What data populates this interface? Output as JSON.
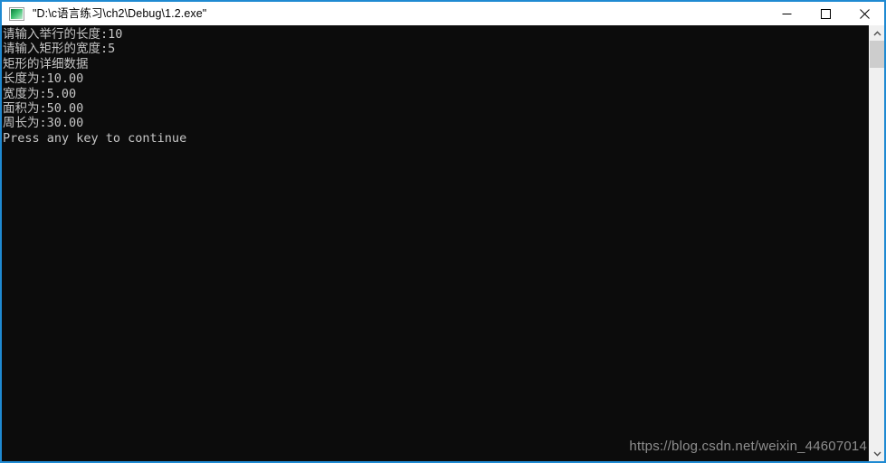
{
  "window": {
    "title": "\"D:\\c语言练习\\ch2\\Debug\\1.2.exe\"",
    "icon": "console-app-icon",
    "border_color": "#1f8ad2",
    "titlebar_bg": "#ffffff",
    "console_bg": "#0c0c0c",
    "console_fg": "#c6c6c6",
    "controls": {
      "minimize_label": "minimize",
      "maximize_label": "maximize",
      "close_label": "close"
    }
  },
  "console": {
    "lines": [
      "请输入举行的长度:10",
      "请输入矩形的宽度:5",
      "矩形的详细数据",
      "长度为:10.00",
      "宽度为:5.00",
      "面积为:50.00",
      "周长为:30.00",
      "Press any key to continue"
    ],
    "text": "请输入举行的长度:10\n请输入矩形的宽度:5\n矩形的详细数据\n长度为:10.00\n宽度为:5.00\n面积为:50.00\n周长为:30.00\nPress any key to continue"
  },
  "watermark": {
    "text": "https://blog.csdn.net/weixin_44607014",
    "color": "#8e8e8e"
  },
  "scrollbar": {
    "up_arrow": "chevron-up-icon",
    "down_arrow": "chevron-down-icon",
    "thumb_position": "top",
    "track_color": "#f0f0f0",
    "thumb_color": "#cdcdcd"
  }
}
